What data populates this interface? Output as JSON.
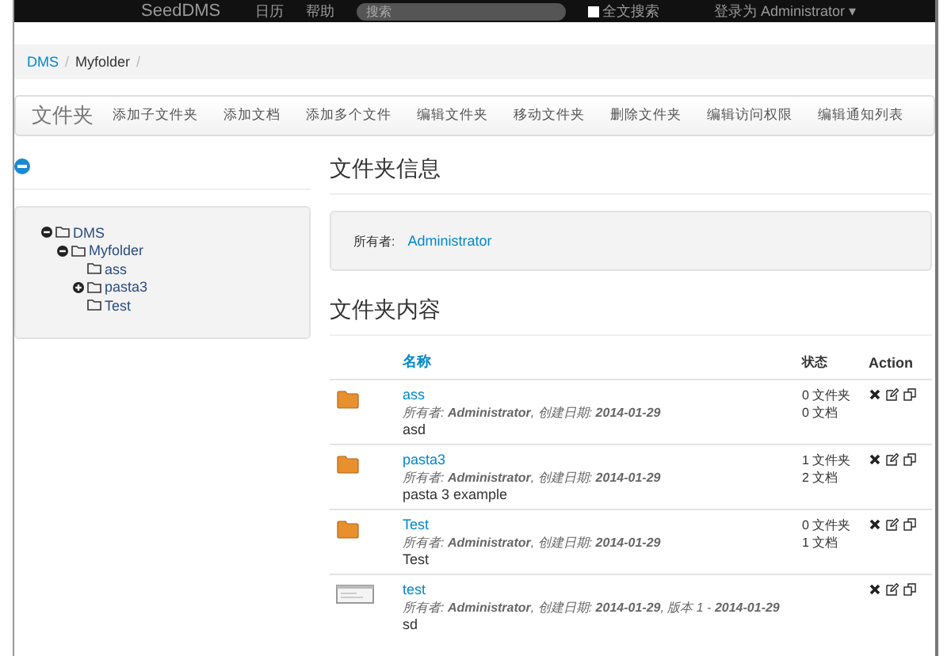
{
  "navbar": {
    "brand": "SeedDMS",
    "links": [
      "日历",
      "帮助"
    ],
    "search": {
      "placeholder": "搜索"
    },
    "fulltext": {
      "label": "全文搜索",
      "checked": false
    },
    "user": "登录为 Administrator ▾"
  },
  "breadcrumb": {
    "items": [
      "DMS",
      "Myfolder"
    ],
    "separator": "/"
  },
  "toolbar": {
    "title": "文件夹",
    "actions": [
      "添加子文件夹",
      "添加文档",
      "添加多个文件",
      "编辑文件夹",
      "移动文件夹",
      "删除文件夹",
      "编辑访问权限",
      "编辑通知列表"
    ]
  },
  "tree": {
    "nodes": [
      {
        "label": "DMS",
        "expanded": true,
        "children": [
          {
            "label": "Myfolder",
            "expanded": true,
            "children": [
              {
                "label": "ass"
              },
              {
                "label": "pasta3",
                "expanded": false
              },
              {
                "label": "Test"
              }
            ]
          }
        ]
      }
    ]
  },
  "folder_info": {
    "heading": "文件夹信息",
    "owner_label": "所有者:",
    "owner": "Administrator"
  },
  "folder_content": {
    "heading": "文件夹内容",
    "columns": [
      "名称",
      "状态",
      "Action"
    ],
    "rows": [
      {
        "kind": "folder",
        "name": "ass",
        "meta": "所有者: **Administrator**, 创建日期: **2014-01-29**",
        "comment": "asd",
        "status": [
          "0 文件夹",
          "0 文档"
        ]
      },
      {
        "kind": "folder",
        "name": "pasta3",
        "meta": "所有者: **Administrator**, 创建日期: **2014-01-29**",
        "comment": "pasta 3 example",
        "status": [
          "1 文件夹",
          "2 文档"
        ]
      },
      {
        "kind": "folder",
        "name": "Test",
        "meta": "所有者: **Administrator**, 创建日期: **2014-01-29**",
        "comment": "Test",
        "status": [
          "0 文件夹",
          "1 文档"
        ]
      },
      {
        "kind": "document",
        "name": "test",
        "meta": "所有者: **Administrator**, 创建日期: **2014-01-29**, 版本 1 - **2014-01-29**",
        "comment": "sd"
      }
    ]
  }
}
